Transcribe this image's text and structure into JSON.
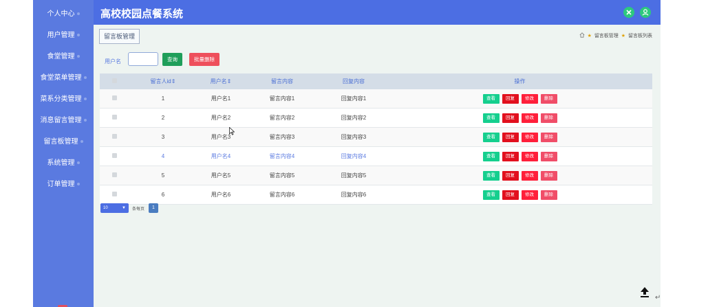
{
  "app": {
    "title": "高校校园点餐系统"
  },
  "sidebar": {
    "items": [
      {
        "label": "个人中心"
      },
      {
        "label": "用户管理"
      },
      {
        "label": "食堂管理"
      },
      {
        "label": "食堂菜单管理"
      },
      {
        "label": "菜系分类管理"
      },
      {
        "label": "消息留言管理"
      },
      {
        "label": "留言板管理"
      },
      {
        "label": "系统管理"
      },
      {
        "label": "订单管理"
      }
    ]
  },
  "header": {
    "icons": [
      "close-icon",
      "user-icon"
    ],
    "colors": {
      "bar": "#4c6ee3",
      "icon_bg": "#2dc97e"
    }
  },
  "page": {
    "tab_label": "留言板管理",
    "breadcrumb": [
      "留言板管理",
      "留言板列表"
    ]
  },
  "search": {
    "label": "用户名",
    "value": "",
    "placeholder": "",
    "query_label": "查询",
    "batch_delete_label": "批量删除"
  },
  "table": {
    "columns": [
      "留言人id⇕",
      "用户名⇕",
      "留言内容",
      "回复内容",
      "操作"
    ],
    "actions": {
      "view": "查看",
      "reply": "回复",
      "edit": "修改",
      "delete": "删除"
    },
    "rows": [
      {
        "id": "1",
        "username": "用户名1",
        "content": "留言内容1",
        "reply": "回复内容1",
        "highlighted": false
      },
      {
        "id": "2",
        "username": "用户名2",
        "content": "留言内容2",
        "reply": "回复内容2",
        "highlighted": false
      },
      {
        "id": "3",
        "username": "用户名3",
        "content": "留言内容3",
        "reply": "回复内容3",
        "highlighted": false
      },
      {
        "id": "4",
        "username": "用户名4",
        "content": "留言内容4",
        "reply": "回复内容4",
        "highlighted": true
      },
      {
        "id": "5",
        "username": "用户名5",
        "content": "留言内容5",
        "reply": "回复内容5",
        "highlighted": false
      },
      {
        "id": "6",
        "username": "用户名6",
        "content": "留言内容6",
        "reply": "回复内容6",
        "highlighted": false
      }
    ]
  },
  "pagination": {
    "page_size": "10",
    "per_page_label": "条每页",
    "current_page": "1"
  },
  "colors": {
    "sidebar": "#5a7ae0",
    "main_bg": "#eef4f1",
    "query_button": "#1f9e5a",
    "batch_delete_button": "#ee4f5c",
    "view_button": "#15cf8e",
    "reply_button": "#e2101e",
    "edit_button": "#ff1f3a",
    "delete_button": "#f04d68"
  }
}
